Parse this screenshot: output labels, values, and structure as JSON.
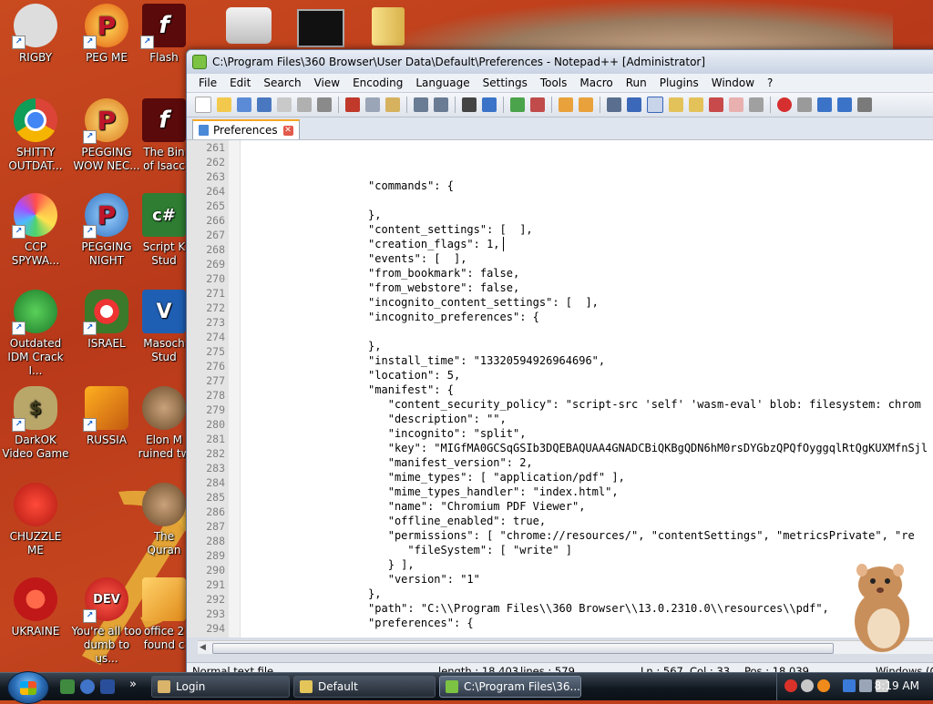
{
  "desktop": {
    "icons": [
      {
        "label": "RIGBY"
      },
      {
        "label": "PEG ME"
      },
      {
        "label": "Flash"
      },
      {
        "label": "SHITTY OUTDAT..."
      },
      {
        "label": "PEGGING WOW NEC..."
      },
      {
        "label": "The Bin of Isacc"
      },
      {
        "label": "CCP SPYWA..."
      },
      {
        "label": "PEGGING NIGHT"
      },
      {
        "label": "Script K Stud"
      },
      {
        "label": "Outdated IDM Crack I..."
      },
      {
        "label": "ISRAEL"
      },
      {
        "label": "Masoch Stud"
      },
      {
        "label": "DarkOK Video Game"
      },
      {
        "label": "RUSSIA"
      },
      {
        "label": "Elon M ruined tw"
      },
      {
        "label": "CHUZZLE ME"
      },
      {
        "label": "The Quran"
      },
      {
        "label": "UKRAINE"
      },
      {
        "label": "You're all too dumb to us..."
      },
      {
        "label": "office 2 found c"
      }
    ]
  },
  "window": {
    "title": "C:\\Program Files\\360 Browser\\User Data\\Default\\Preferences - Notepad++ [Administrator]",
    "menu": [
      "File",
      "Edit",
      "Search",
      "View",
      "Encoding",
      "Language",
      "Settings",
      "Tools",
      "Macro",
      "Run",
      "Plugins",
      "Window",
      "?"
    ],
    "tab": {
      "label": "Preferences"
    },
    "lines": [
      {
        "n": "261",
        "t": "                  \"commands\": {"
      },
      {
        "n": "262",
        "t": ""
      },
      {
        "n": "263",
        "t": "                  },"
      },
      {
        "n": "264",
        "t": "                  \"content_settings\": [  ],"
      },
      {
        "n": "265",
        "t": "                  \"creation_flags\": 1,"
      },
      {
        "n": "266",
        "t": "                  \"events\": [  ],"
      },
      {
        "n": "267",
        "t": "                  \"from_bookmark\": false,"
      },
      {
        "n": "268",
        "t": "                  \"from_webstore\": false,"
      },
      {
        "n": "269",
        "t": "                  \"incognito_content_settings\": [  ],"
      },
      {
        "n": "270",
        "t": "                  \"incognito_preferences\": {"
      },
      {
        "n": "271",
        "t": ""
      },
      {
        "n": "272",
        "t": "                  },"
      },
      {
        "n": "273",
        "t": "                  \"install_time\": \"13320594926964696\","
      },
      {
        "n": "274",
        "t": "                  \"location\": 5,"
      },
      {
        "n": "275",
        "t": "                  \"manifest\": {"
      },
      {
        "n": "276",
        "t": "                     \"content_security_policy\": \"script-src 'self' 'wasm-eval' blob: filesystem: chrom"
      },
      {
        "n": "277",
        "t": "                     \"description\": \"\","
      },
      {
        "n": "278",
        "t": "                     \"incognito\": \"split\","
      },
      {
        "n": "279",
        "t": "                     \"key\": \"MIGfMA0GCSqGSIb3DQEBAQUAA4GNADCBiQKBgQDN6hM0rsDYGbzQPQfOyggqlRtQgKUXMfnSjl"
      },
      {
        "n": "280",
        "t": "                     \"manifest_version\": 2,"
      },
      {
        "n": "281",
        "t": "                     \"mime_types\": [ \"application/pdf\" ],"
      },
      {
        "n": "282",
        "t": "                     \"mime_types_handler\": \"index.html\","
      },
      {
        "n": "283",
        "t": "                     \"name\": \"Chromium PDF Viewer\","
      },
      {
        "n": "284",
        "t": "                     \"offline_enabled\": true,"
      },
      {
        "n": "285",
        "t": "                     \"permissions\": [ \"chrome://resources/\", \"contentSettings\", \"metricsPrivate\", \"re"
      },
      {
        "n": "286",
        "t": "                        \"fileSystem\": [ \"write\" ]"
      },
      {
        "n": "287",
        "t": "                     } ],"
      },
      {
        "n": "288",
        "t": "                     \"version\": \"1\""
      },
      {
        "n": "289",
        "t": "                  },"
      },
      {
        "n": "290",
        "t": "                  \"path\": \"C:\\\\Program Files\\\\360 Browser\\\\13.0.2310.0\\\\resources\\\\pdf\","
      },
      {
        "n": "291",
        "t": "                  \"preferences\": {"
      },
      {
        "n": "292",
        "t": ""
      },
      {
        "n": "293",
        "t": "                  },"
      },
      {
        "n": "294",
        "t": "                  \"regular_only_preferences\": {"
      }
    ],
    "status": {
      "type": "Normal text file",
      "length": "length : 18,403",
      "lines": "lines : 579",
      "ln": "Ln : 567",
      "col": "Col : 33",
      "pos": "Pos : 18,039",
      "eol": "Windows (C"
    }
  },
  "taskbar": {
    "buttons": [
      {
        "label": "Login"
      },
      {
        "label": "Default"
      },
      {
        "label": "C:\\Program Files\\36..."
      }
    ],
    "clock": "8:19 AM"
  }
}
